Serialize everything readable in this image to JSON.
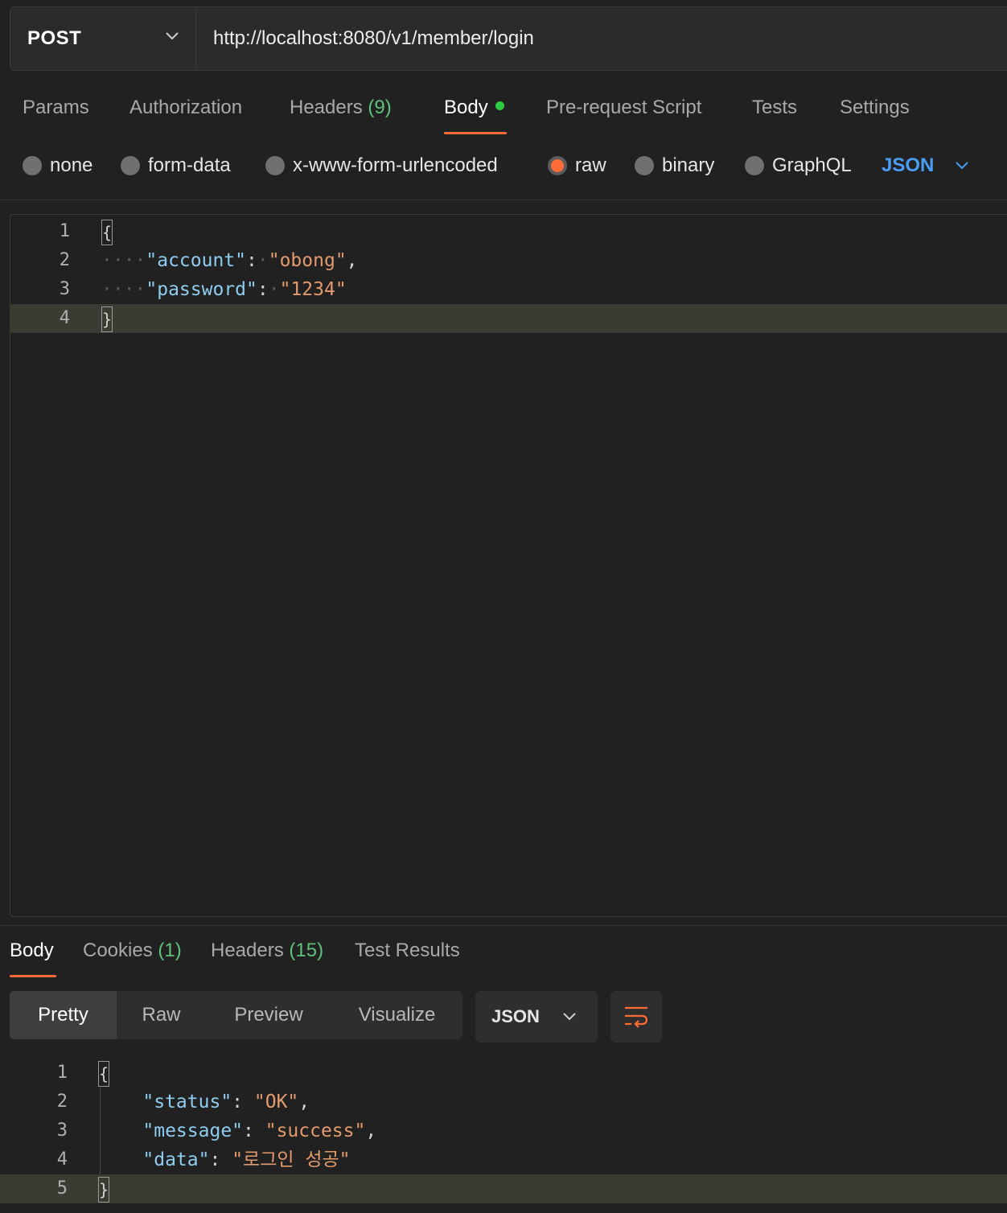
{
  "request": {
    "method": "POST",
    "url": "http://localhost:8080/v1/member/login"
  },
  "req_tabs": {
    "params": "Params",
    "authorization": "Authorization",
    "headers": "Headers",
    "headers_count": "(9)",
    "body": "Body",
    "prerequest": "Pre-request Script",
    "tests": "Tests",
    "settings": "Settings"
  },
  "body_types": {
    "none": "none",
    "form_data": "form-data",
    "urlencoded": "x-www-form-urlencoded",
    "raw": "raw",
    "binary": "binary",
    "graphql": "GraphQL",
    "selected": "raw",
    "language": "JSON"
  },
  "request_body": {
    "line_numbers": [
      "1",
      "2",
      "3",
      "4"
    ],
    "open_brace": "{",
    "close_brace": "}",
    "key1": "\"account\"",
    "val1": "\"obong\"",
    "key2": "\"password\"",
    "val2": "\"1234\""
  },
  "res_tabs": {
    "body": "Body",
    "cookies": "Cookies",
    "cookies_count": "(1)",
    "headers": "Headers",
    "headers_count": "(15)",
    "tests": "Test Results"
  },
  "view_modes": {
    "pretty": "Pretty",
    "raw": "Raw",
    "preview": "Preview",
    "visualize": "Visualize",
    "format": "JSON"
  },
  "response_body": {
    "line_numbers": [
      "1",
      "2",
      "3",
      "4",
      "5"
    ],
    "open_brace": "{",
    "close_brace": "}",
    "key1": "\"status\"",
    "val1": "\"OK\"",
    "key2": "\"message\"",
    "val2": "\"success\"",
    "key3": "\"data\"",
    "val3": "\"로그인 성공\""
  },
  "colors": {
    "accent": "#ff6c37",
    "json_key": "#8ecdf0",
    "json_string": "#e39a6c",
    "count_green": "#5fc17a",
    "link_blue": "#4a9cf5"
  },
  "icons": {
    "method_dropdown": "chevron-down-icon",
    "language_dropdown": "chevron-down-icon",
    "format_dropdown": "chevron-down-icon",
    "wrap": "wrap-lines-icon"
  }
}
